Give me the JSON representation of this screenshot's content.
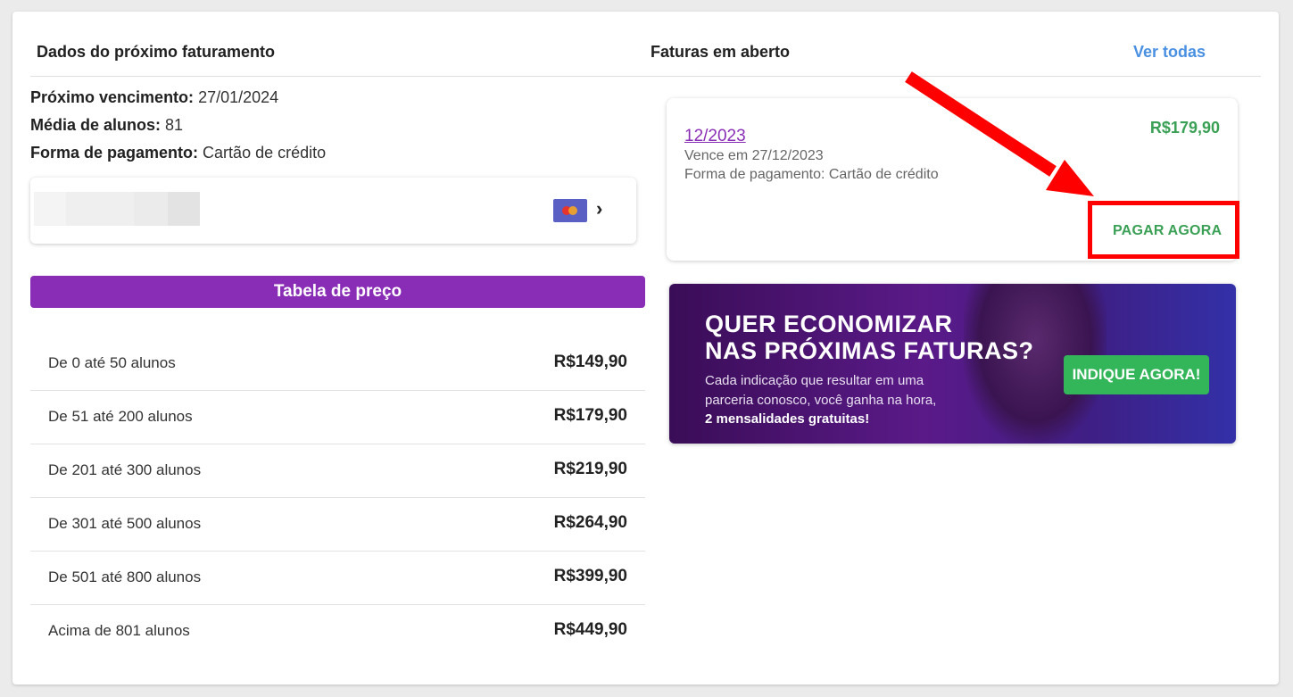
{
  "header": {
    "left_title": "Dados do próximo faturamento",
    "right_title": "Faturas em aberto",
    "see_all": "Ver todas"
  },
  "billing": {
    "next_due_label": "Próximo vencimento:",
    "next_due_value": "27/01/2024",
    "avg_students_label": "Média de alunos:",
    "avg_students_value": "81",
    "payment_label": "Forma de pagamento:",
    "payment_value": "Cartão de crédito",
    "card_brand_icon": "mastercard-icon"
  },
  "price_table": {
    "title": "Tabela de preço",
    "rows": [
      {
        "label": "De 0 até 50 alunos",
        "price": "R$149,90"
      },
      {
        "label": "De 51 até 200 alunos",
        "price": "R$179,90"
      },
      {
        "label": "De 201 até 300 alunos",
        "price": "R$219,90"
      },
      {
        "label": "De 301 até 500 alunos",
        "price": "R$264,90"
      },
      {
        "label": "De 501 até 800 alunos",
        "price": "R$399,90"
      },
      {
        "label": "Acima de 801 alunos",
        "price": "R$449,90"
      }
    ]
  },
  "invoice": {
    "month": "12/2023",
    "due": "Vence em 27/12/2023",
    "payment": "Forma de pagamento: Cartão de crédito",
    "amount": "R$179,90",
    "pay_now": "PAGAR AGORA"
  },
  "banner": {
    "title_line1": "QUER ECONOMIZAR",
    "title_line2": "NAS PRÓXIMAS FATURAS?",
    "body_line1": "Cada indicação que resultar em uma",
    "body_line2": "parceria conosco, você ganha na hora,",
    "body_line3": "2 mensalidades gratuitas!",
    "cta": "INDIQUE AGORA!"
  },
  "colors": {
    "accent_purple": "#8a2db6",
    "link_blue": "#4a90e2",
    "success_green": "#3aa055",
    "annotation_red": "#ff0000"
  }
}
